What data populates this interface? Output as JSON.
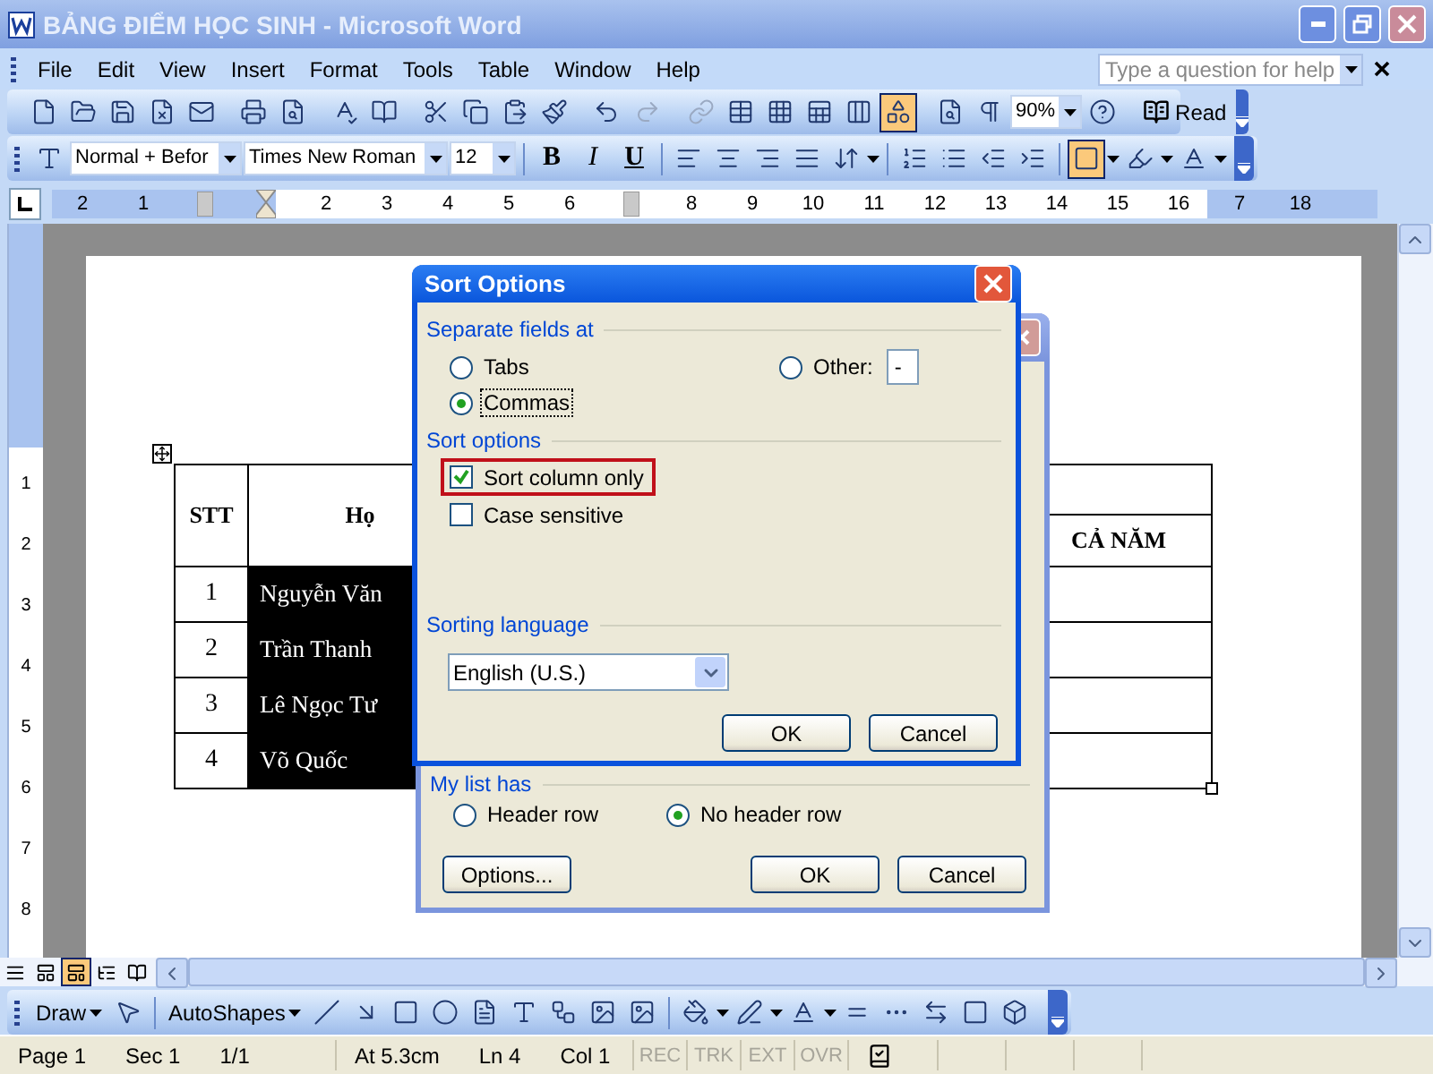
{
  "window": {
    "title": "BẢNG ĐIỂM HỌC SINH - Microsoft Word"
  },
  "menu": [
    "File",
    "Edit",
    "View",
    "Insert",
    "Format",
    "Tools",
    "Table",
    "Window",
    "Help"
  ],
  "help_box": {
    "placeholder": "Type a question for help"
  },
  "standard_toolbar": {
    "drawing_toggle": {
      "pressed": true
    },
    "zoom": "90%",
    "read": "Read"
  },
  "formatting_toolbar": {
    "style": "Normal + Befor",
    "font": "Times New Roman",
    "size": "12",
    "bold": "B",
    "italic": "I",
    "underline": "U",
    "borders_toggle": {
      "pressed": true
    }
  },
  "ruler": [
    {
      "kind": "number",
      "label": "2"
    },
    {
      "kind": "number",
      "label": "1"
    },
    {
      "kind": "grid"
    },
    {
      "kind": "indent"
    },
    {
      "kind": "number",
      "label": "2"
    },
    {
      "kind": "number",
      "label": "3"
    },
    {
      "kind": "number",
      "label": "4"
    },
    {
      "kind": "number",
      "label": "5"
    },
    {
      "kind": "number",
      "label": "6"
    },
    {
      "kind": "grid"
    },
    {
      "kind": "number",
      "label": "8"
    },
    {
      "kind": "number",
      "label": "9"
    },
    {
      "kind": "number",
      "label": "10"
    },
    {
      "kind": "number",
      "label": "11"
    },
    {
      "kind": "number",
      "label": "12"
    },
    {
      "kind": "number",
      "label": "13"
    },
    {
      "kind": "number",
      "label": "14"
    },
    {
      "kind": "number",
      "label": "15"
    },
    {
      "kind": "number",
      "label": "16"
    },
    {
      "kind": "number",
      "label": "7"
    },
    {
      "kind": "number",
      "label": "18"
    }
  ],
  "vertical_ruler": [
    "1",
    "2",
    "3",
    "4",
    "5",
    "6",
    "7",
    "8"
  ],
  "table": {
    "headers": [
      "STT",
      "Họ",
      "CẢ NĂM"
    ],
    "rows": [
      {
        "stt": "1",
        "name": "Nguyễn Văn",
        "selected": true
      },
      {
        "stt": "2",
        "name": "Trần Thanh",
        "selected": true
      },
      {
        "stt": "3",
        "name": "Lê Ngọc Tư",
        "selected": true
      },
      {
        "stt": "4",
        "name": "Võ Quốc",
        "selected": true
      }
    ]
  },
  "sort_dialog": {
    "group": "My list has",
    "options": [
      {
        "label": "Header row",
        "selected": false
      },
      {
        "label": "No header row",
        "selected": true
      }
    ],
    "buttons": [
      "Options...",
      "OK",
      "Cancel"
    ]
  },
  "sort_options_dialog": {
    "title": "Sort Options",
    "separate_label": "Separate fields at",
    "separators": [
      {
        "label": "Tabs",
        "selected": false
      },
      {
        "label": "Commas",
        "selected": true
      },
      {
        "label": "Other:",
        "selected": false
      }
    ],
    "other_value": "-",
    "options_label": "Sort options",
    "checks": [
      {
        "label": "Sort column only",
        "checked": true,
        "highlighted": true
      },
      {
        "label": "Case sensitive",
        "checked": false,
        "highlighted": false
      }
    ],
    "language_label": "Sorting language",
    "language": "English (U.S.)",
    "buttons": [
      "OK",
      "Cancel"
    ]
  },
  "view_buttons": [
    {
      "selected": false
    },
    {
      "selected": false
    },
    {
      "selected": true
    },
    {
      "selected": false
    },
    {
      "selected": false
    }
  ],
  "drawing_toolbar": {
    "draw": "Draw",
    "autoshapes": "AutoShapes"
  },
  "status_bar": [
    {
      "items": [
        "Page 1",
        "Sec 1",
        "1/1"
      ]
    },
    {
      "items": [
        "At 5.3cm",
        "Ln 4",
        "Col 1"
      ]
    }
  ],
  "indicators": [
    {
      "label": "REC",
      "disabled": true
    },
    {
      "label": "TRK",
      "disabled": true
    },
    {
      "label": "EXT",
      "disabled": true
    },
    {
      "label": "OVR",
      "disabled": true
    }
  ]
}
